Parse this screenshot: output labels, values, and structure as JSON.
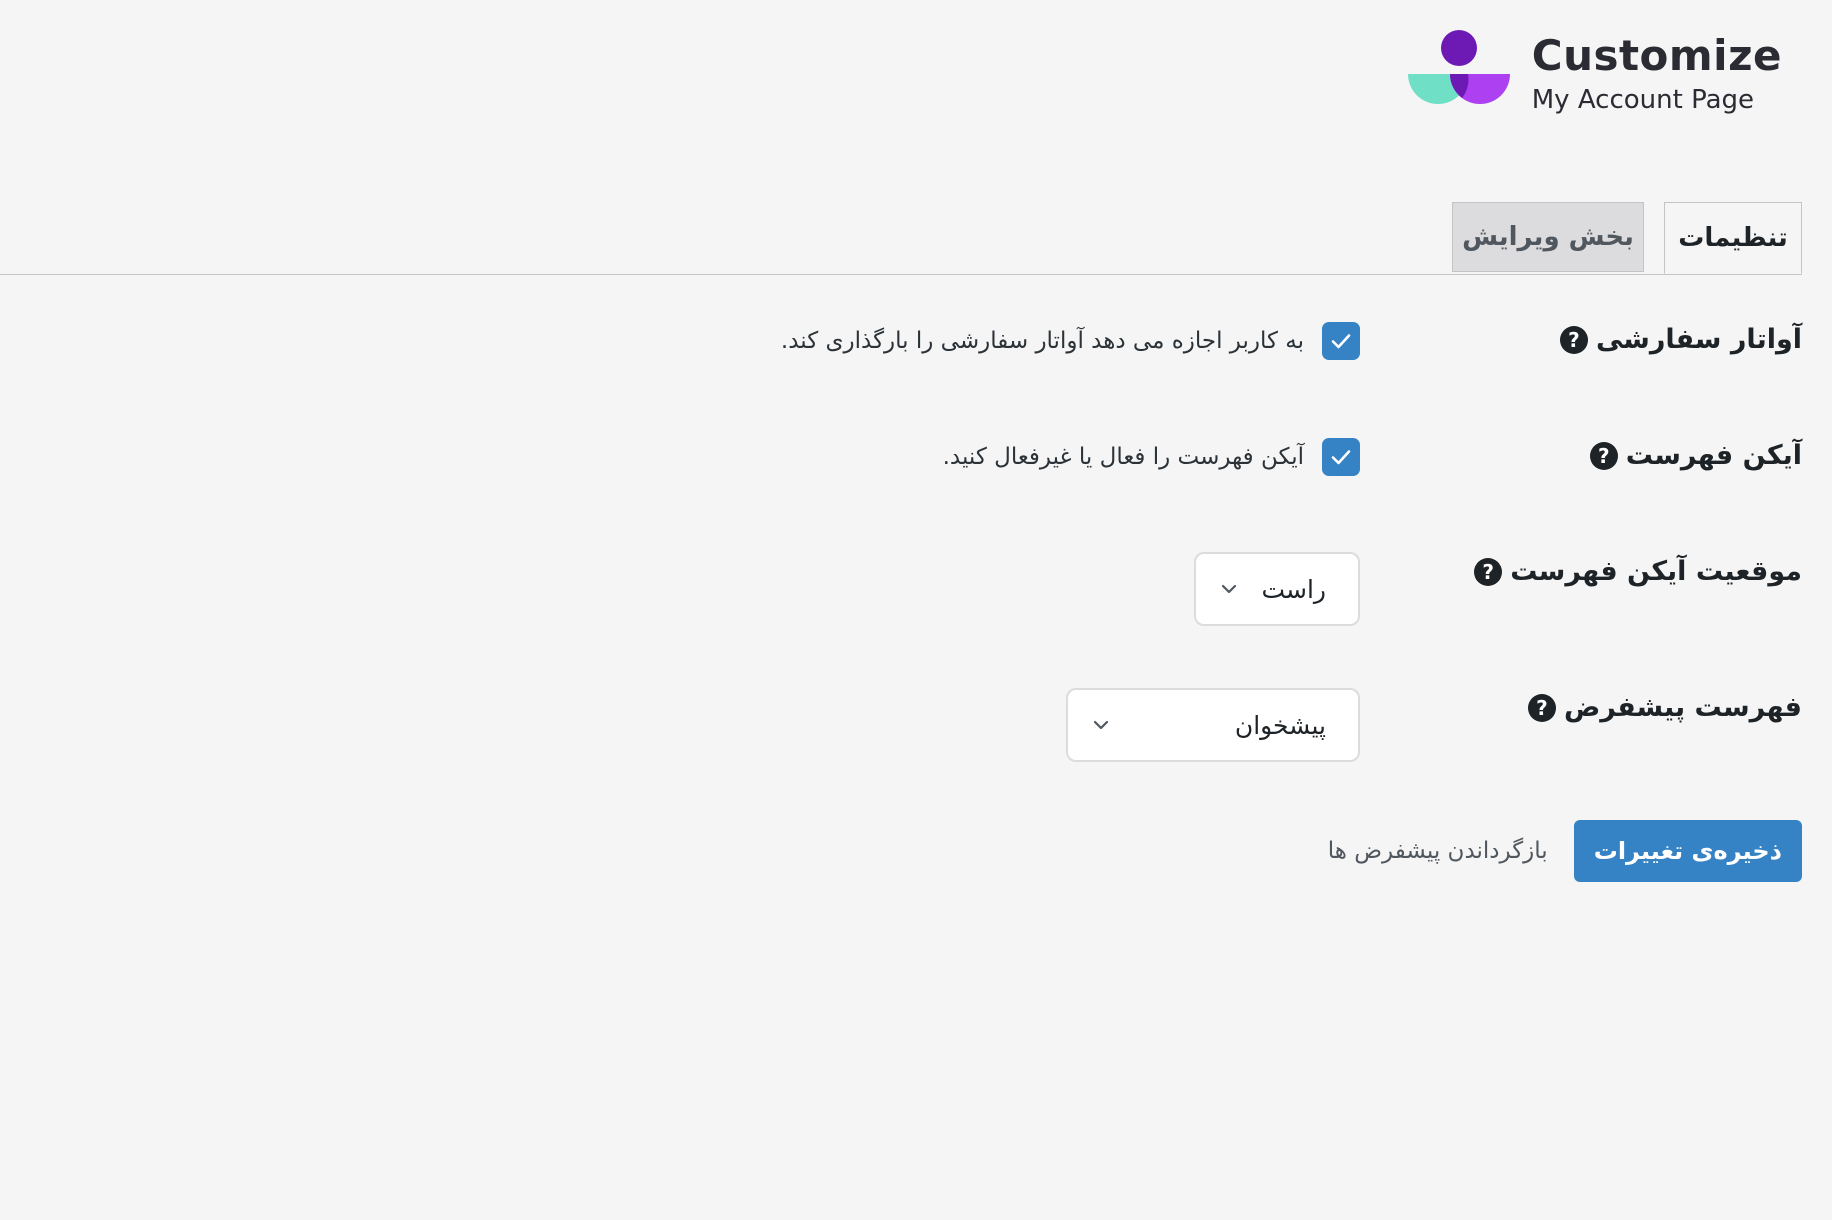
{
  "logo": {
    "title": "Customize",
    "subtitle": "My Account Page",
    "colors": {
      "purple_dark": "#6d1ab5",
      "purple_light": "#a52cf0",
      "teal": "#6fe0c5"
    }
  },
  "tabs": [
    {
      "label": "تنظیمات",
      "active": true
    },
    {
      "label": "بخش ویرایش",
      "active": false
    }
  ],
  "settings": {
    "custom_avatar": {
      "label": "آواتار سفارشی",
      "help_icon": "question-circle-icon",
      "checked": true,
      "description": "به کاربر اجازه می دهد آواتار سفارشی را بارگذاری کند."
    },
    "menu_icon": {
      "label": "آیکن فهرست",
      "help_icon": "question-circle-icon",
      "checked": true,
      "description": "آیکن فهرست را فعال یا غیرفعال کنید."
    },
    "menu_icon_position": {
      "label": "موقعیت آیکن فهرست",
      "help_icon": "question-circle-icon",
      "selected": "راست"
    },
    "default_menu": {
      "label": "فهرست پیشفرض",
      "help_icon": "question-circle-icon",
      "selected": "پیشخوان"
    }
  },
  "actions": {
    "save_label": "ذخیره‌ی تغییرات",
    "reset_label": "بازگرداندن پیشفرض ها"
  },
  "colors": {
    "accent": "#3582c4",
    "background": "#f5f5f5",
    "text": "#1d2327"
  }
}
